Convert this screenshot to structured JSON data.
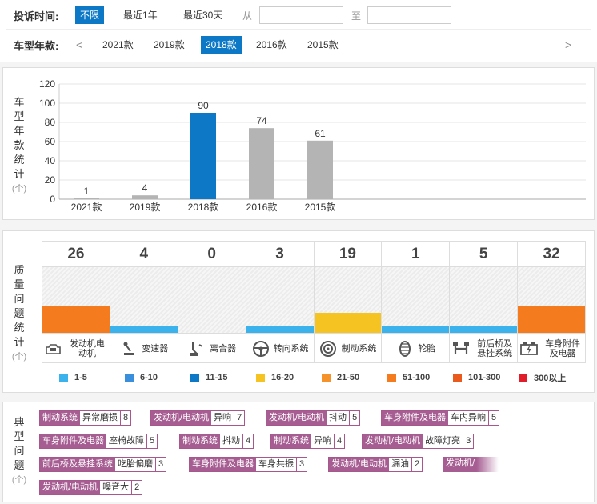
{
  "filter": {
    "time_label": "投诉时间:",
    "time_options": [
      "不限",
      "最近1年",
      "最近30天"
    ],
    "from_label": "从",
    "to_label": "至",
    "year_label": "车型年款:",
    "prev_arrow": "<",
    "next_arrow": ">",
    "year_options": [
      "2021款",
      "2019款",
      "2018款",
      "2016款",
      "2015款"
    ]
  },
  "year_panel": {
    "title": [
      "车",
      "型",
      "年",
      "款",
      "统",
      "计"
    ],
    "unit": "(个)"
  },
  "chart_data": {
    "type": "bar",
    "categories": [
      "2021款",
      "2019款",
      "2018款",
      "2016款",
      "2015款"
    ],
    "values": [
      1,
      4,
      90,
      74,
      61
    ],
    "highlight_index": 2,
    "colors": {
      "default": "#b4b4b4",
      "highlight": "#0d78c6"
    },
    "yticks": [
      0,
      20,
      40,
      60,
      80,
      100,
      120
    ],
    "ylim": [
      0,
      120
    ],
    "grid": true
  },
  "quality_panel": {
    "title": [
      "质",
      "量",
      "问",
      "题",
      "统",
      "计"
    ],
    "unit": "(个)",
    "items": [
      {
        "label": "发动机电动机",
        "count": "26",
        "level": 0.4,
        "color": "#f47b1e",
        "icon": "engine-icon"
      },
      {
        "label": "变速器",
        "count": "4",
        "level": 0.1,
        "color": "#3cb2ec",
        "icon": "gearshift-icon"
      },
      {
        "label": "离合器",
        "count": "0",
        "level": 0,
        "color": "#3cb2ec",
        "icon": "clutch-icon"
      },
      {
        "label": "转向系统",
        "count": "3",
        "level": 0.1,
        "color": "#3cb2ec",
        "icon": "steering-wheel-icon"
      },
      {
        "label": "制动系统",
        "count": "19",
        "level": 0.3,
        "color": "#f5c322",
        "icon": "brake-disc-icon"
      },
      {
        "label": "轮胎",
        "count": "1",
        "level": 0.1,
        "color": "#3cb2ec",
        "icon": "tire-icon"
      },
      {
        "label": "前后桥及悬挂系统",
        "count": "5",
        "level": 0.1,
        "color": "#3cb2ec",
        "icon": "suspension-icon"
      },
      {
        "label": "车身附件及电器",
        "count": "32",
        "level": 0.4,
        "color": "#f47b1e",
        "icon": "battery-icon"
      }
    ],
    "legend": [
      {
        "label": "1-5",
        "color": "#3cb2ec"
      },
      {
        "label": "6-10",
        "color": "#3a8fdc"
      },
      {
        "label": "11-15",
        "color": "#0d78c6"
      },
      {
        "label": "16-20",
        "color": "#f5c322"
      },
      {
        "label": "21-50",
        "color": "#f6922a"
      },
      {
        "label": "51-100",
        "color": "#f47b1e"
      },
      {
        "label": "101-300",
        "color": "#ea5a1c"
      },
      {
        "label": "300以上",
        "color": "#e11d29"
      }
    ]
  },
  "typical_panel": {
    "title": [
      "典",
      "型",
      "问",
      "题"
    ],
    "unit": "(个)",
    "tags": [
      {
        "category": "制动系统",
        "issue": "异常磨损",
        "count": "8"
      },
      {
        "category": "发动机/电动机",
        "issue": "异响",
        "count": "7"
      },
      {
        "category": "发动机/电动机",
        "issue": "抖动",
        "count": "5"
      },
      {
        "category": "车身附件及电器",
        "issue": "车内异响",
        "count": "5"
      },
      {
        "category": "车身附件及电器",
        "issue": "座椅故障",
        "count": "5"
      },
      {
        "category": "制动系统",
        "issue": "抖动",
        "count": "4"
      },
      {
        "category": "制动系统",
        "issue": "异响",
        "count": "4"
      },
      {
        "category": "发动机/电动机",
        "issue": "故障灯亮",
        "count": "3"
      },
      {
        "category": "前后桥及悬挂系统",
        "issue": "吃胎偏磨",
        "count": "3"
      },
      {
        "category": "车身附件及电器",
        "issue": "车身共振",
        "count": "3"
      },
      {
        "category": "发动机/电动机",
        "issue": "漏油",
        "count": "2"
      },
      {
        "category": "发动机/",
        "issue": "",
        "count": ""
      },
      {
        "category": "发动机/电动机",
        "issue": "噪音大",
        "count": "2"
      }
    ]
  }
}
